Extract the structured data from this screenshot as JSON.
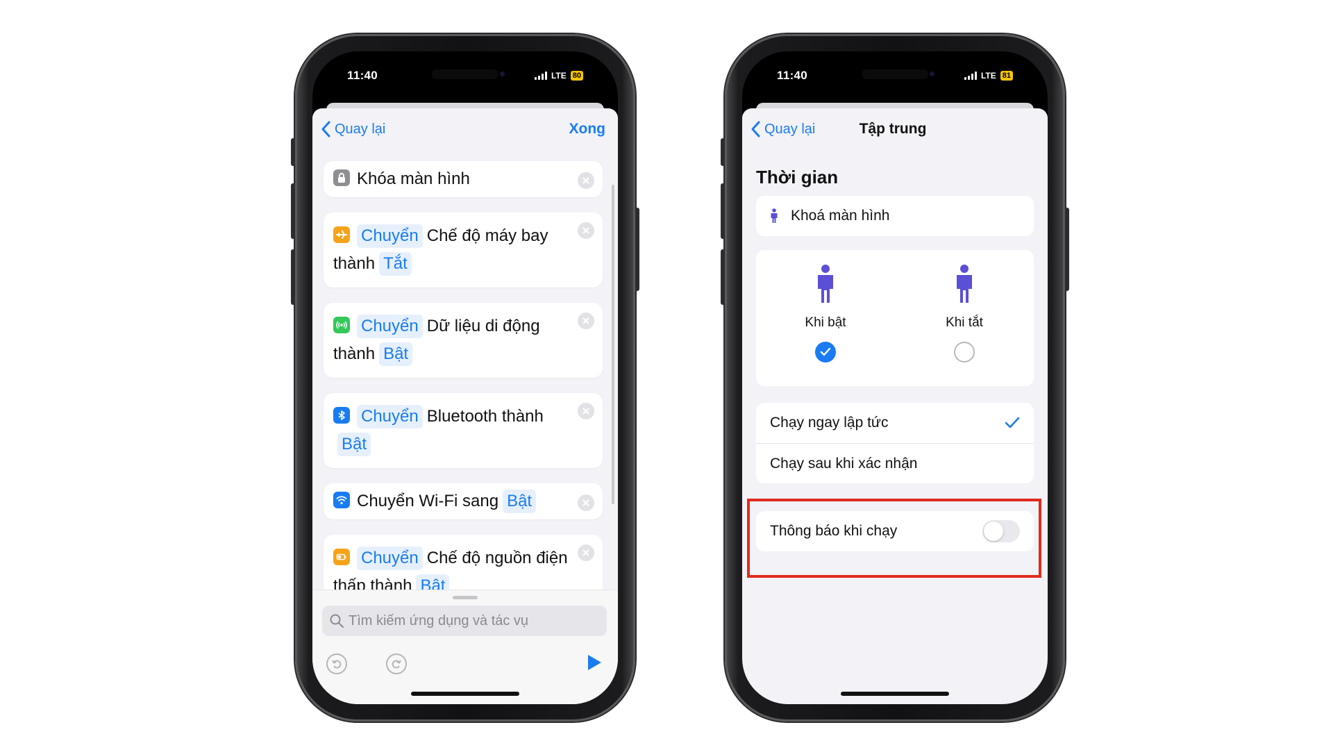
{
  "colors": {
    "accent": "#1a7cf2",
    "highlight": "#e02b1e"
  },
  "left_phone": {
    "status": {
      "time": "11:40",
      "network": "LTE",
      "battery": "80"
    },
    "nav": {
      "back_label": "Quay lại",
      "done_label": "Xong"
    },
    "actions": [
      {
        "icon": "lock-icon",
        "text": "Khóa màn hình"
      },
      {
        "icon": "airplane-icon",
        "verb": "Chuyển",
        "text": "Chế độ máy bay thành",
        "value": "Tắt"
      },
      {
        "icon": "cellular-icon",
        "verb": "Chuyển",
        "text": "Dữ liệu di động thành",
        "value": "Bật"
      },
      {
        "icon": "bluetooth-icon",
        "verb": "Chuyển",
        "text": "Bluetooth thành",
        "value": "Bật"
      },
      {
        "icon": "wifi-icon",
        "text": "Chuyển Wi-Fi sang",
        "value": "Bật"
      },
      {
        "icon": "battery-icon",
        "verb": "Chuyển",
        "text": "Chế độ nguồn điện thấp thành",
        "value": "Bật"
      }
    ],
    "search": {
      "placeholder": "Tìm kiếm ứng dụng và tác vụ"
    }
  },
  "right_phone": {
    "status": {
      "time": "11:40",
      "network": "LTE",
      "battery": "81"
    },
    "nav": {
      "back_label": "Quay lại",
      "title": "Tập trung"
    },
    "section_title": "Thời gian",
    "trigger_row": "Khoá màn hình",
    "options": {
      "on_label": "Khi bật",
      "off_label": "Khi tắt",
      "selected": "on"
    },
    "run_modes": {
      "immediate": "Chạy ngay lập tức",
      "after_confirm": "Chạy sau khi xác nhận",
      "selected": "immediate"
    },
    "notify": {
      "label": "Thông báo khi chạy",
      "enabled": false
    }
  }
}
